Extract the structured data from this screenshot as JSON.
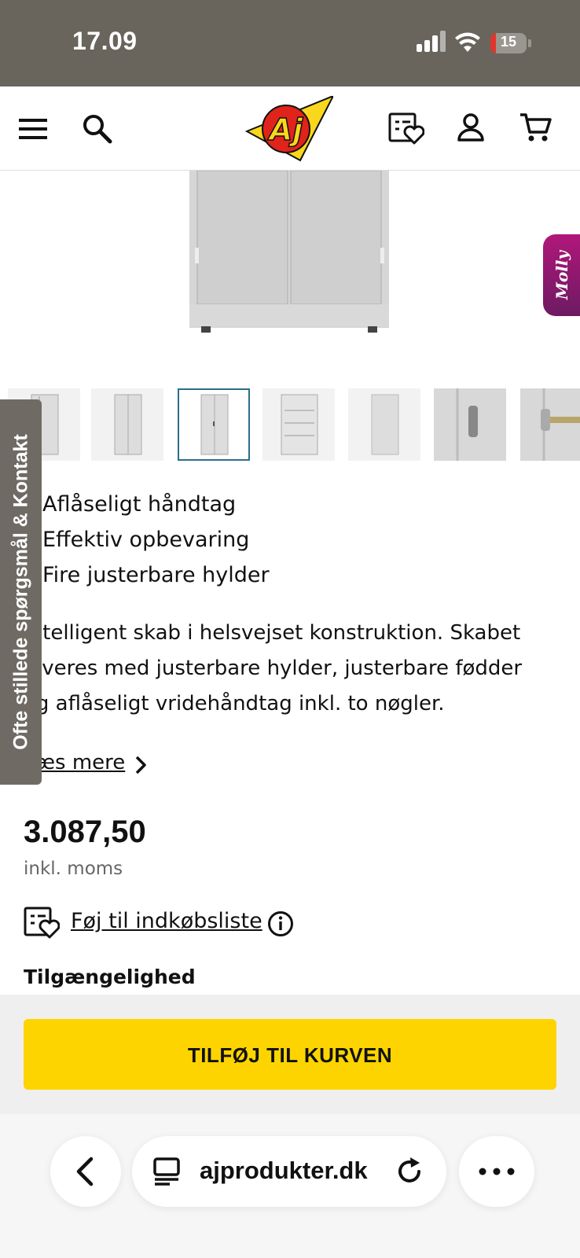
{
  "status_bar": {
    "time": "17.09",
    "battery": "15",
    "battery_level": 0.15
  },
  "header": {
    "menu_icon": "hamburger-menu-icon",
    "search_icon": "search-icon",
    "logo_text": "Aj",
    "shopping_list_icon": "shopping-list-heart-icon",
    "account_icon": "user-icon",
    "cart_icon": "cart-icon"
  },
  "product": {
    "features": [
      "Aflåseligt håndtag",
      "Effektiv opbevaring",
      "Fire justerbare hylder"
    ],
    "description_lines": [
      "Intelligent skab i helsvejset konstruktion. Skabet",
      "leveres med justerbare hylder, justerbare fødder",
      "og aflåseligt vridehåndtag inkl. to nøgler."
    ],
    "read_more": "Læs mere",
    "price": "3.087,50",
    "vat_note": "inkl. moms",
    "add_to_list": "Føj til indkøbsliste",
    "availability_heading": "Tilgængelighed",
    "add_to_cart": "TILFØJ TIL KURVEN"
  },
  "side_tab": {
    "label": "Ofte stillede spørgsmål & Kontakt"
  },
  "assistant_tab": {
    "label": "Molly"
  },
  "browser": {
    "url": "ajprodukter.dk"
  },
  "colors": {
    "accent_yellow": "#fdd400",
    "status_gray": "#69645c",
    "thumb_selected": "#2a6f8a",
    "molly_magenta": "#b0177a"
  }
}
